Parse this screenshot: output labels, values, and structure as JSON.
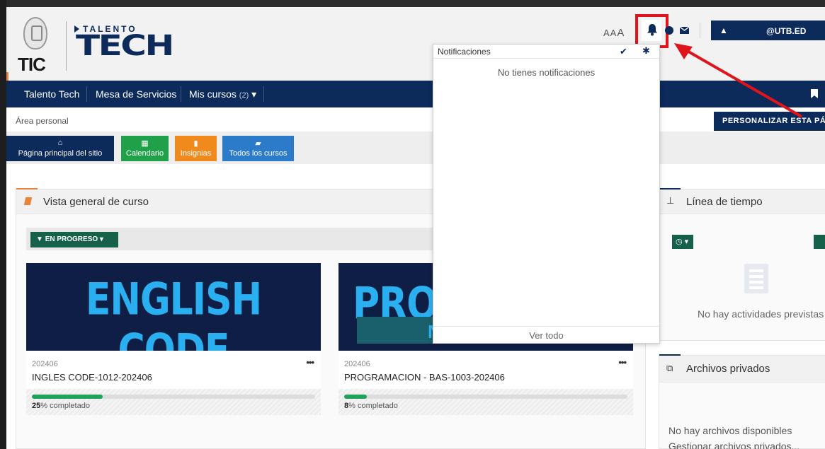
{
  "header": {
    "logo_tic": "TIC",
    "logo_talento": "TALENTO",
    "logo_tech": "TECH",
    "font_sizer": [
      "A",
      "A",
      "A"
    ],
    "user_label": "@UTB.ED",
    "icons": [
      "bell-icon",
      "chat-icon",
      "mail-icon",
      "user-icon"
    ]
  },
  "nav": {
    "items": [
      {
        "label": "Talento Tech"
      },
      {
        "label": "Mesa de Servicios"
      },
      {
        "label": "Mis cursos",
        "count": "(2)",
        "caret": "▾"
      }
    ]
  },
  "breadcrumb": "Área personal",
  "customize_button": "PERSONALIZAR ESTA PÁ",
  "quick_buttons": [
    {
      "label": "Página principal del sitio",
      "icon": "home-icon",
      "color": "#0c2a5a"
    },
    {
      "label": "Calendario",
      "icon": "calendar-icon",
      "color": "#21a04a"
    },
    {
      "label": "Insignias",
      "icon": "bookmark-icon",
      "color": "#f08a1d"
    },
    {
      "label": "Todos los cursos",
      "icon": "book-icon",
      "color": "#2b7bc9"
    }
  ],
  "overview": {
    "title": "Vista general de curso",
    "filter_label": "EN PROGRESO",
    "courses": [
      {
        "image_text": "ENGLISH CODE",
        "image_sub": "",
        "term": "202406",
        "name": "INGLES CODE-1012-202406",
        "percent": "25",
        "percent_value": 0.25,
        "suffix": "% completado"
      },
      {
        "image_text": "PROG",
        "image_sub": "NI",
        "term": "202406",
        "name": "PROGRAMACION - BAS-1003-202406",
        "percent": "8",
        "percent_value": 0.08,
        "suffix": "% completado"
      }
    ]
  },
  "timeline": {
    "title": "Línea de tiempo",
    "empty_text": "No hay actividades previstas"
  },
  "files": {
    "title": "Archivos privados",
    "empty_text": "No hay archivos disponibles",
    "manage_text": "Gestionar archivos privados..."
  },
  "notifications": {
    "title": "Notificaciones",
    "empty_text": "No tienes notificaciones",
    "footer": "Ver todo"
  },
  "colors": {
    "navy": "#0c2a5a",
    "green": "#16614a",
    "progress": "#1fa35a",
    "accent_orange": "#e8843a",
    "highlight_red": "#e0151c"
  }
}
